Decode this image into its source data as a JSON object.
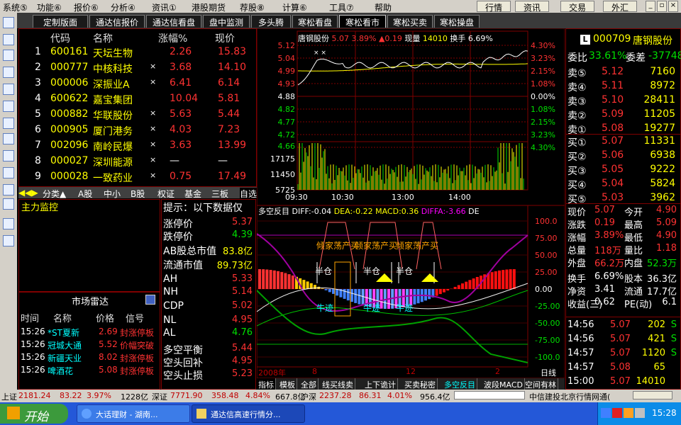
{
  "menubar": {
    "items": [
      "系统⑤",
      "功能⑥",
      "报价⑥",
      "分析④",
      "资讯①",
      "港股期货",
      "荐股⑧",
      "计算⑥",
      "工具⑦",
      "帮助"
    ],
    "right_buttons": [
      "行情",
      "资讯",
      "交易",
      "外汇"
    ]
  },
  "tabs": [
    "定制版面",
    "通达信报价",
    "通达信看盘",
    "盘中监测",
    "多头腾",
    "寒松看盘",
    "寒松看市",
    "寒松买卖",
    "寒松操盘"
  ],
  "stocklist": {
    "headers": [
      "代码",
      "名称",
      "涨幅%",
      "现价"
    ],
    "rows": [
      {
        "no": "1",
        "code": "600161",
        "name": "天坛生物",
        "mark": "",
        "chg": "2.26",
        "price": "15.83",
        "cc": "red"
      },
      {
        "no": "2",
        "code": "000777",
        "name": "中核科技",
        "mark": "×",
        "chg": "3.68",
        "price": "14.10",
        "cc": "red"
      },
      {
        "no": "3",
        "code": "000006",
        "name": "深振业A",
        "mark": "×",
        "chg": "6.41",
        "price": "6.14",
        "cc": "red"
      },
      {
        "no": "4",
        "code": "600622",
        "name": "嘉宝集团",
        "mark": "",
        "chg": "10.04",
        "price": "5.81",
        "cc": "red"
      },
      {
        "no": "5",
        "code": "000882",
        "name": "华联股份",
        "mark": "×",
        "chg": "5.63",
        "price": "5.44",
        "cc": "red"
      },
      {
        "no": "6",
        "code": "000905",
        "name": "厦门港务",
        "mark": "×",
        "chg": "4.03",
        "price": "7.23",
        "cc": "red"
      },
      {
        "no": "7",
        "code": "002096",
        "name": "南岭民爆",
        "mark": "×",
        "chg": "3.63",
        "price": "13.99",
        "cc": "red"
      },
      {
        "no": "8",
        "code": "000027",
        "name": "深圳能源",
        "mark": "×",
        "chg": "—",
        "price": "—",
        "cc": "white"
      },
      {
        "no": "9",
        "code": "000028",
        "name": "一致药业",
        "mark": "×",
        "chg": "0.75",
        "price": "17.49",
        "cc": "red"
      }
    ]
  },
  "subtabs": [
    "分类▲",
    "A股",
    "中小",
    "B股",
    "权证",
    "基金",
    "三板",
    "自选"
  ],
  "monitor": {
    "title": "主力监控"
  },
  "radar": {
    "title": "市场雷达",
    "headers": [
      "时间",
      "名称",
      "价格",
      "信号"
    ],
    "rows": [
      {
        "time": "15:26",
        "name": "*ST夏新",
        "price": "2.69",
        "signal": "封涨停板"
      },
      {
        "time": "15:26",
        "name": "冠城大通",
        "price": "5.52",
        "signal": "价幅突破"
      },
      {
        "time": "15:26",
        "name": "新疆天业",
        "price": "8.02",
        "signal": "封涨停板"
      },
      {
        "time": "15:26",
        "name": "啤酒花",
        "price": "5.08",
        "signal": "封涨停板"
      }
    ]
  },
  "datatip": {
    "title": "提示：以下数据仅",
    "rows": [
      {
        "l": "涨停价",
        "v": "5.37"
      },
      {
        "l": "跌停价",
        "v": "4.39"
      },
      {
        "l": "AB股总市值",
        "v": "83.8亿"
      },
      {
        "l": "流通市值",
        "v": "89.73亿"
      },
      {
        "l": "AH",
        "v": "5.33"
      },
      {
        "l": "NH",
        "v": "5.14"
      },
      {
        "l": "CDP",
        "v": "5.02"
      },
      {
        "l": "NL",
        "v": "4.95"
      },
      {
        "l": "AL",
        "v": "4.76"
      },
      {
        "l": "多空平衡",
        "v": "5.44"
      },
      {
        "l": "空头回补",
        "v": "4.95"
      },
      {
        "l": "空头止损",
        "v": "5.23"
      }
    ]
  },
  "chart": {
    "header": {
      "name": "唐钢股份",
      "price": "5.07",
      "pct": "3.89%",
      "chg": "▲0.19",
      "vol_label": "现量",
      "vol": "14010",
      "turn_label": "换手",
      "turn": "6.69%"
    },
    "left_labels": [
      "5.12",
      "5.04",
      "4.99",
      "4.93",
      "4.88",
      "4.82",
      "4.77",
      "4.72",
      "4.66",
      "17175",
      "11450",
      "5725"
    ],
    "right_labels": [
      "4.30%",
      "3.23%",
      "2.15%",
      "1.08%",
      "0.00%",
      "1.08%",
      "2.15%",
      "3.23%",
      "4.30%"
    ],
    "time_labels": [
      "09:30",
      "10:30",
      "13:00",
      "14:00"
    ]
  },
  "indicator": {
    "header": {
      "name": "多空反目",
      "diff": "DIFF:-0.04",
      "dea": "DEA:-0.22",
      "macd": "MACD:0.36",
      "diffa": "DIFFA:-3.66",
      "de": "DE"
    },
    "right_labels": [
      "100.0",
      "75.00",
      "50.00",
      "25.00",
      "0.00",
      "-25.00",
      "-50.00",
      "-75.00",
      "-100.0"
    ],
    "annotations": [
      "倾家荡产买",
      "倾家荡产买",
      "倾家荡产买",
      "半仓",
      "半仓",
      "半仓",
      "牛迹",
      "牛迹",
      "牛迹"
    ],
    "date_labels": [
      "2008年",
      "8",
      "12",
      "2",
      "日线"
    ]
  },
  "bottomtabs": [
    "指标",
    "模板",
    "全部",
    "线买线卖",
    "上下诡计",
    "买卖秘密",
    "多空反目",
    "波段MACD",
    "空间有林"
  ],
  "quote": {
    "code": "000709",
    "name": "唐钢股份",
    "weibi_label": "委比",
    "weibi": "33.61%",
    "weicha_label": "委差",
    "weicha": "-37748",
    "asks": [
      {
        "l": "卖⑤",
        "p": "5.12",
        "v": "7160"
      },
      {
        "l": "卖④",
        "p": "5.11",
        "v": "8972"
      },
      {
        "l": "卖③",
        "p": "5.10",
        "v": "28411"
      },
      {
        "l": "卖②",
        "p": "5.09",
        "v": "11205"
      },
      {
        "l": "卖①",
        "p": "5.08",
        "v": "19277"
      }
    ],
    "bids": [
      {
        "l": "买①",
        "p": "5.07",
        "v": "11331"
      },
      {
        "l": "买②",
        "p": "5.06",
        "v": "6938"
      },
      {
        "l": "买③",
        "p": "5.05",
        "v": "9222"
      },
      {
        "l": "买④",
        "p": "5.04",
        "v": "5824"
      },
      {
        "l": "买⑤",
        "p": "5.03",
        "v": "3962"
      }
    ],
    "stats": [
      [
        "现价",
        "5.07",
        "今开",
        "4.90"
      ],
      [
        "涨跌",
        "0.19",
        "最高",
        "5.09"
      ],
      [
        "涨幅",
        "3.89%",
        "最低",
        "4.90"
      ],
      [
        "总量",
        "118万",
        "量比",
        "1.18"
      ],
      [
        "外盘",
        "66.2万",
        "内盘",
        "52.3万"
      ],
      [
        "换手",
        "6.69%",
        "股本",
        "36.3亿"
      ],
      [
        "净资",
        "3.41",
        "流通",
        "17.7亿"
      ],
      [
        "收益(三)",
        "0.62",
        "PE(动)",
        "6.1"
      ]
    ],
    "ticks": [
      {
        "t": "14:56",
        "p": "5.07",
        "v": "202",
        "f": "S"
      },
      {
        "t": "14:56",
        "p": "5.07",
        "v": "421",
        "f": "S"
      },
      {
        "t": "14:57",
        "p": "5.07",
        "v": "1120",
        "f": "S"
      },
      {
        "t": "14:57",
        "p": "5.08",
        "v": "65",
        "f": ""
      },
      {
        "t": "15:00",
        "p": "5.07",
        "v": "14010",
        "f": ""
      }
    ]
  },
  "statusbar": {
    "sh_label": "上证",
    "sh": "2181.24",
    "sh_chg": "83.22",
    "sh_pct": "3.97%",
    "sh_amt": "1228亿",
    "sz_label": "深证",
    "sz": "7771.90",
    "sz_chg": "358.48",
    "sz_pct": "4.84%",
    "sz_amt": "667.8亿",
    "hs_label": "沪深",
    "hs": "2237.28",
    "hs_chg": "86.31",
    "hs_pct": "4.01%",
    "hs_amt": "956.4亿",
    "broker": "中信建投北京行情网通("
  },
  "taskbar": {
    "start": "开始",
    "tasks": [
      "大话理财 - 湖南...",
      "通达信高速行情分..."
    ],
    "clock": "15:28"
  },
  "colors": {
    "up": "#ff3232",
    "down": "#00e000",
    "price_line": "#ffffff",
    "avg_line": "#ffff00",
    "grid": "#800000"
  }
}
